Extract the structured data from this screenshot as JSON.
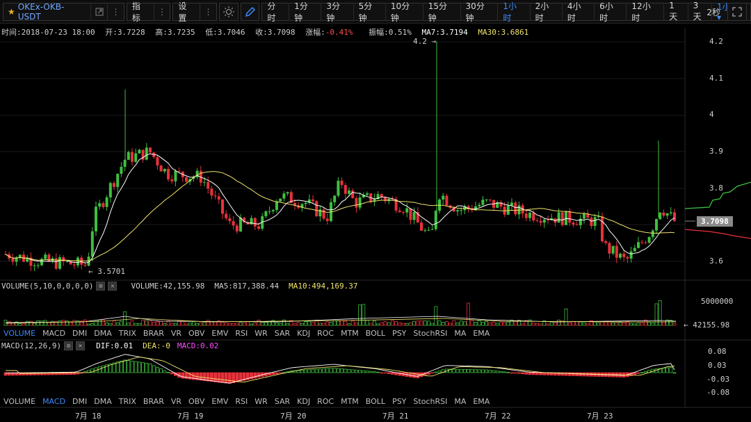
{
  "toolbar": {
    "symbol": "OKEx-OKB-USDT",
    "indicators_label": "指标",
    "settings_label": "设置",
    "intervals": [
      "分时",
      "1分钟",
      "3分钟",
      "5分钟",
      "10分钟",
      "15分钟",
      "30分钟",
      "1小时",
      "2小时",
      "4小时",
      "6小时",
      "12小时",
      "1天",
      "3天"
    ],
    "active_interval": "1小时",
    "interval_select": "1小时",
    "refresh_label": "2秒"
  },
  "info": {
    "time": "时间:2018-07-23 18:00",
    "open": "开:3.7228",
    "high": "高:3.7235",
    "low": "低:3.7046",
    "close": "收:3.7098",
    "change": "涨幅:-0.41%",
    "amplitude": "振幅:0.51%",
    "ma7": "MA7:3.7194",
    "ma30": "MA30:3.6861"
  },
  "colors": {
    "up": "#3fbf3f",
    "down": "#e8313b",
    "accent": "#3d8bff",
    "ma_white": "#ffffff",
    "ma_yellow": "#f2e56b"
  },
  "price_axis": [
    "4.2",
    "4.1",
    "4",
    "3.9",
    "3.8",
    "3.7",
    "3.6"
  ],
  "current_price": "3.7098",
  "high_marker": "4.2",
  "low_marker": "3.5701",
  "volume": {
    "label": "VOLUME(5,10,0,0,0,0)",
    "value": "VOLUME:42,155.98",
    "ma5": "MA5:817,388.44",
    "ma10": "MA10:494,169.37",
    "axis": "5000000",
    "last": "42155.98"
  },
  "tabs_volume": [
    "VOLUME",
    "MACD",
    "DMI",
    "DMA",
    "TRIX",
    "BRAR",
    "VR",
    "OBV",
    "EMV",
    "RSI",
    "WR",
    "SAR",
    "KDJ",
    "ROC",
    "MTM",
    "BOLL",
    "PSY",
    "StochRSI",
    "MA",
    "EMA"
  ],
  "tabs_volume_active": "VOLUME",
  "macd": {
    "label": "MACD(12,26,9)",
    "dif": "DIF:0.01",
    "dea": "DEA:-0",
    "macd": "MACD:0.02",
    "axis": [
      "0.08",
      "0.03",
      "-0.03",
      "-0.08"
    ]
  },
  "tabs_macd": [
    "VOLUME",
    "MACD",
    "DMI",
    "DMA",
    "TRIX",
    "BRAR",
    "VR",
    "OBV",
    "EMV",
    "RSI",
    "WR",
    "SAR",
    "KDJ",
    "ROC",
    "MTM",
    "BOLL",
    "PSY",
    "StochRSI",
    "MA",
    "EMA"
  ],
  "tabs_macd_active": "MACD",
  "dates": [
    "7月 18",
    "7月 19",
    "7月 20",
    "7月 21",
    "7月 22",
    "7月 23"
  ]
}
